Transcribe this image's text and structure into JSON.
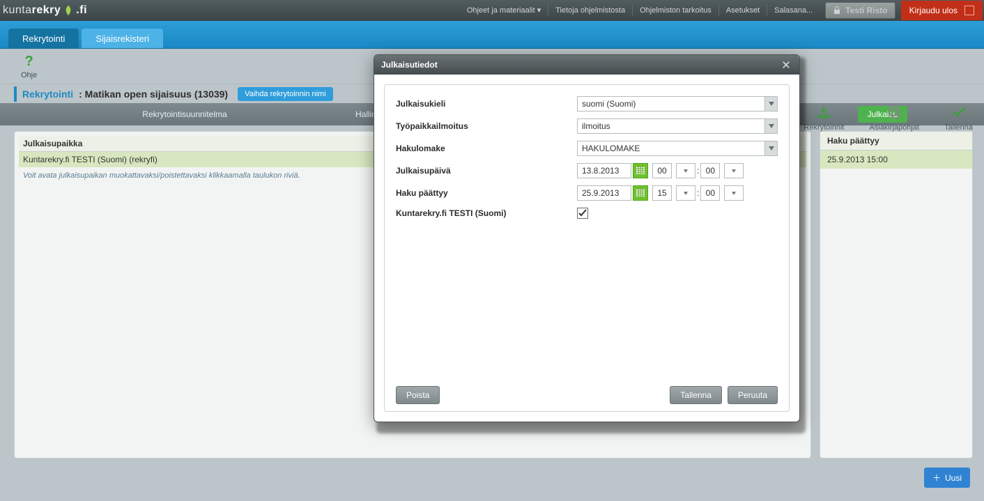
{
  "brand": {
    "part1": "kunta",
    "part2": "rekry",
    "suffix": ".fi"
  },
  "topmenu": {
    "help_materials": "Ohjeet ja materiaalit ▾",
    "about": "Tietoja ohjelmistosta",
    "purpose": "Ohjelmiston tarkoitus",
    "settings": "Asetukset",
    "password": "Salasana..."
  },
  "user": "Testi Risto",
  "logout": "Kirjaudu ulos",
  "tabs": {
    "recruit": "Rekrytointi",
    "subreg": "Sijaisrekisteri"
  },
  "help_label": "Ohje",
  "actions": {
    "recruits": "Rekrytoinnit",
    "docs": "Asiakirjapohjat",
    "save": "Tallenna"
  },
  "crumb": {
    "label": "Rekrytointi",
    "title": ": Matikan open sijaisuus (13039)",
    "rename": "Vaihda rekrytoinnin nimi"
  },
  "subheader": {
    "plan": "Rekrytointisuunnitelma",
    "admin": "Hallin",
    "publish_btn": "Julkaisu"
  },
  "table": {
    "h_place": "Julkaisupaikka",
    "h_form": "Hakulomake",
    "r_place": "Kuntarekry.fi TESTI (Suomi) (rekryfi)",
    "r_form": "HAKULOMAKE",
    "hint": "Voit avata julkaisupaikan muokattavaksi/poistettavaksi klikkaamalla taulukon riviä."
  },
  "rightpanel": {
    "header": "Haku päättyy",
    "value": "25.9.2013 15:00"
  },
  "new_btn": "Uusi",
  "modal": {
    "title": "Julkaisutiedot",
    "lang_label": "Julkaisukieli",
    "lang_value": "suomi (Suomi)",
    "posting_label": "Työpaikkailmoitus",
    "posting_value": "ilmoitus",
    "form_label": "Hakulomake",
    "form_value": "HAKULOMAKE",
    "pubdate_label": "Julkaisupäivä",
    "pubdate_value": "13.8.2013",
    "pubdate_hh": "00",
    "pubdate_mm": "00",
    "enddate_label": "Haku päättyy",
    "enddate_value": "25.9.2013",
    "enddate_hh": "15",
    "enddate_mm": "00",
    "channel_label": "Kuntarekry.fi TESTI (Suomi)",
    "delete": "Poista",
    "save": "Tallenna",
    "cancel": "Peruuta"
  }
}
